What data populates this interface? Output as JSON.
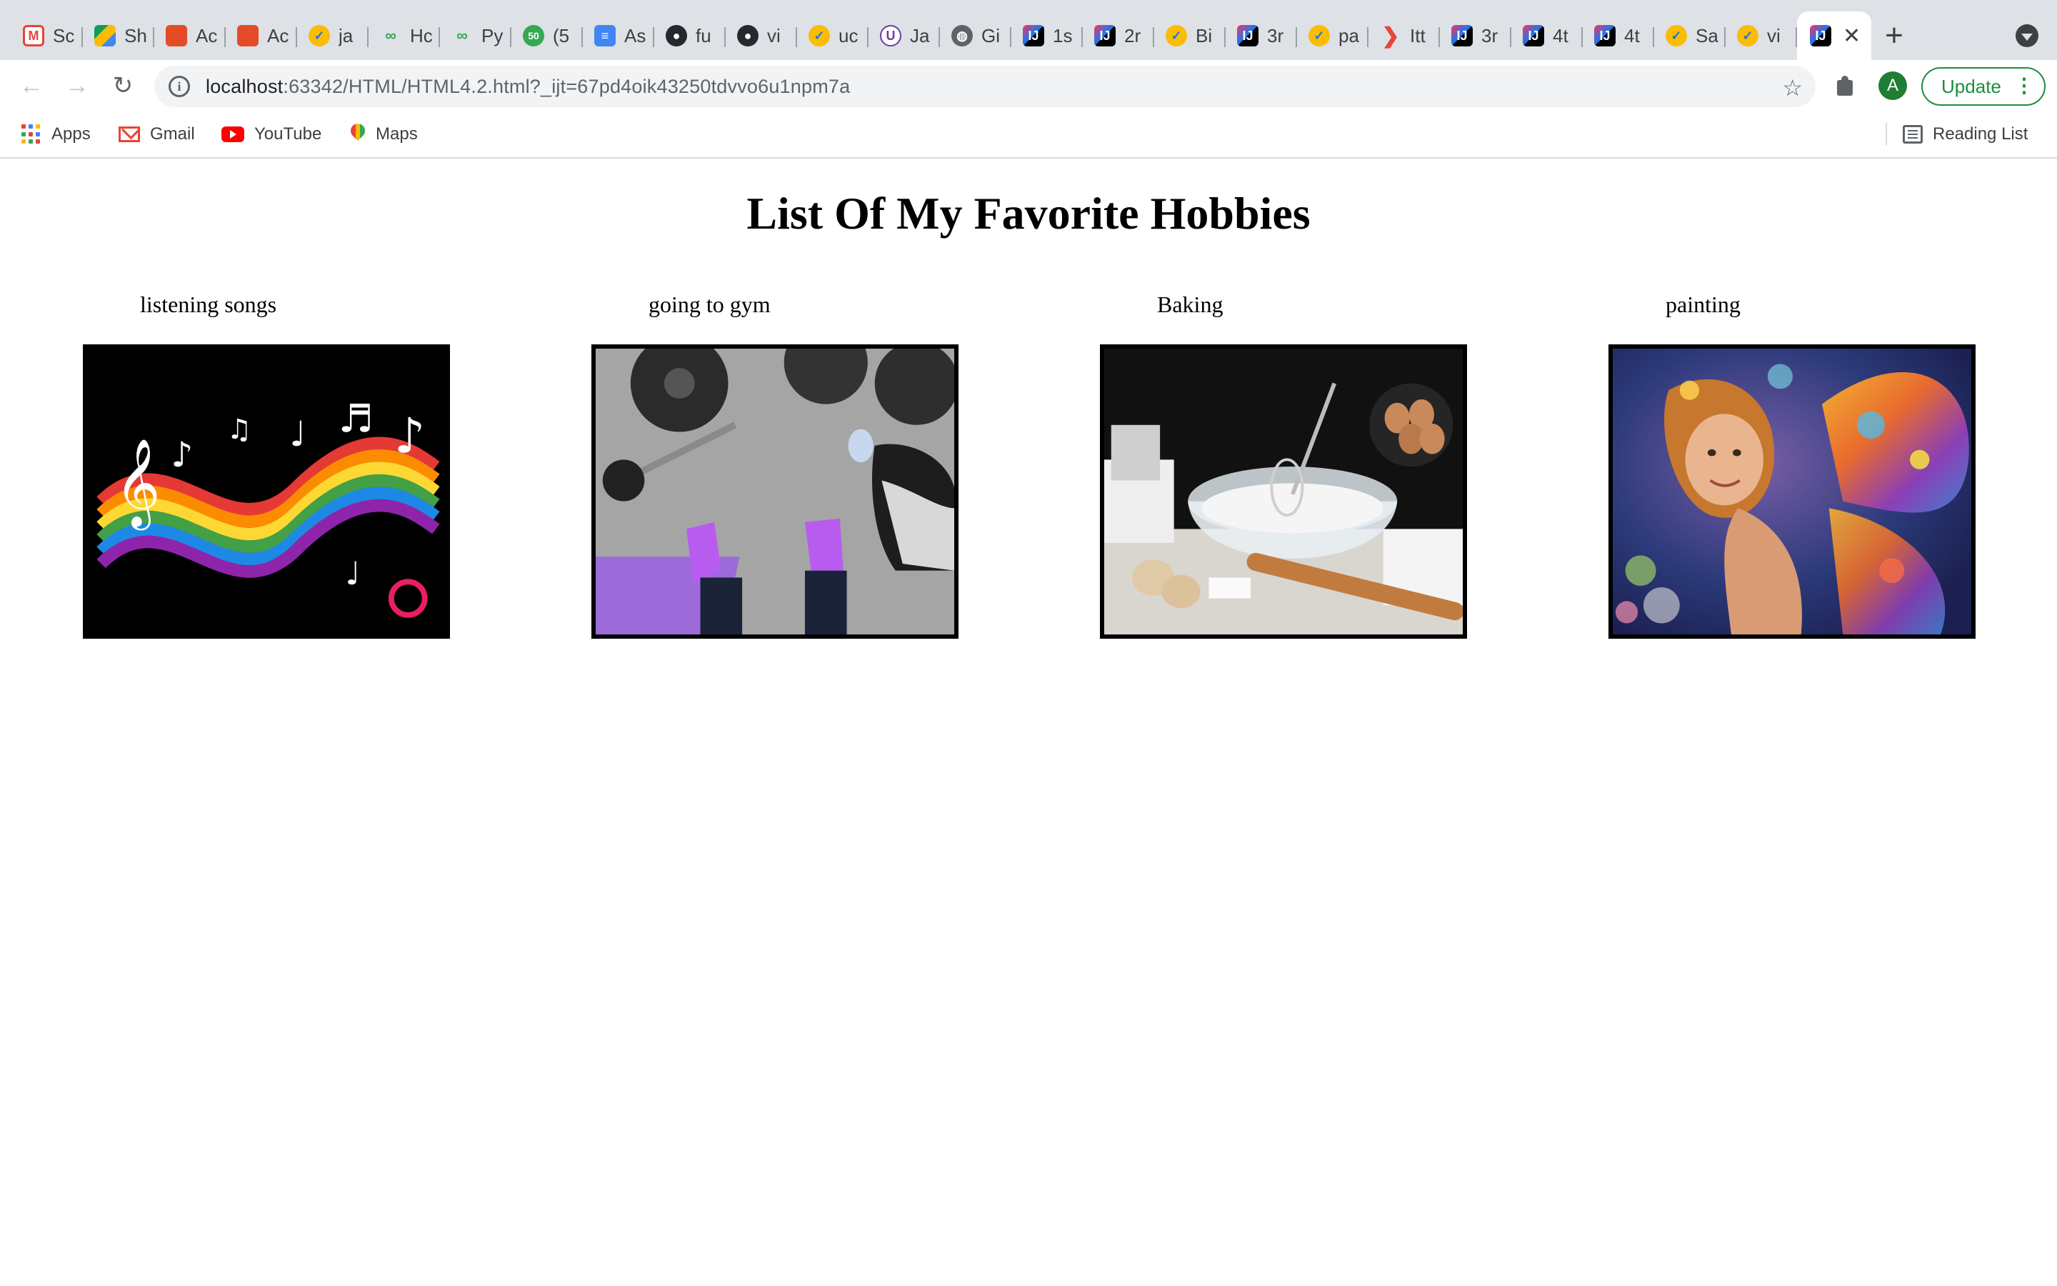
{
  "browser": {
    "tabs": [
      {
        "title": "Sc",
        "favicon": "gmail-icon"
      },
      {
        "title": "Sh",
        "favicon": "google-drive-icon"
      },
      {
        "title": "Ac",
        "favicon": "red-stairs-icon"
      },
      {
        "title": "Ac",
        "favicon": "red-stairs-icon"
      },
      {
        "title": "ja",
        "favicon": "checkmark-icon"
      },
      {
        "title": "Hc",
        "favicon": "green-link-icon"
      },
      {
        "title": "Py",
        "favicon": "green-link-icon"
      },
      {
        "title": "(5",
        "favicon": "counter-50-icon"
      },
      {
        "title": "As",
        "favicon": "google-docs-icon"
      },
      {
        "title": "fu",
        "favicon": "github-icon"
      },
      {
        "title": "vi",
        "favicon": "github-icon"
      },
      {
        "title": "uc",
        "favicon": "checkmark-icon"
      },
      {
        "title": "Ja",
        "favicon": "u-circle-icon"
      },
      {
        "title": "Gi",
        "favicon": "globe-icon"
      },
      {
        "title": "1s",
        "favicon": "intellij-icon"
      },
      {
        "title": "2r",
        "favicon": "intellij-icon"
      },
      {
        "title": "Bi",
        "favicon": "checkmark-icon"
      },
      {
        "title": "3r",
        "favicon": "intellij-icon"
      },
      {
        "title": "pa",
        "favicon": "checkmark-icon"
      },
      {
        "title": "Itt",
        "favicon": "arrow-icon"
      },
      {
        "title": "3r",
        "favicon": "intellij-icon"
      },
      {
        "title": "4t",
        "favicon": "intellij-icon"
      },
      {
        "title": "4t",
        "favicon": "intellij-icon"
      },
      {
        "title": "Sa",
        "favicon": "checkmark-icon"
      },
      {
        "title": "vi",
        "favicon": "checkmark-icon"
      }
    ],
    "active_tab": {
      "favicon": "intellij-icon",
      "close": "✕"
    },
    "new_tab": "+",
    "address": {
      "host": "localhost",
      "rest": ":63342/HTML/HTML4.2.html?_ijt=67pd4oik43250tdvvo6u1npm7a"
    },
    "avatar_initial": "A",
    "update_label": "Update",
    "bookmarks": [
      {
        "label": "Apps",
        "icon": "apps-grid-icon"
      },
      {
        "label": "Gmail",
        "icon": "gmail-icon"
      },
      {
        "label": "YouTube",
        "icon": "youtube-icon"
      },
      {
        "label": "Maps",
        "icon": "maps-pin-icon"
      }
    ],
    "reading_list": "Reading List",
    "colors": {
      "accent_green": "#1e8e3e",
      "tabstrip_bg": "#dee1e6",
      "omnibox_bg": "#f1f3f4"
    }
  },
  "page": {
    "title": "List Of My Favorite Hobbies",
    "hobbies": [
      {
        "label": "listening songs",
        "image": "rainbow-music-notes-image"
      },
      {
        "label": "going to gym",
        "image": "gym-floor-weights-image"
      },
      {
        "label": "Baking",
        "image": "baking-ingredients-image"
      },
      {
        "label": "painting",
        "image": "fairy-painting-image"
      }
    ]
  }
}
